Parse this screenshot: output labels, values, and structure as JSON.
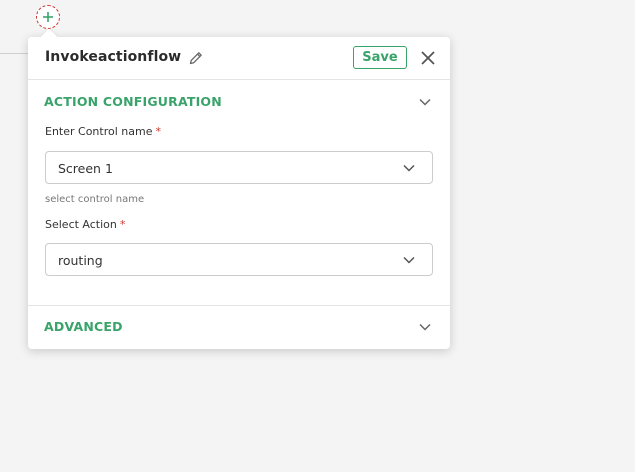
{
  "panel": {
    "title": "Invokeactionflow",
    "save_label": "Save"
  },
  "action_configuration": {
    "heading": "ACTION CONFIGURATION",
    "control_name": {
      "label": "Enter Control name",
      "required_marker": "*",
      "value": "Screen 1",
      "helper": "select control name"
    },
    "action": {
      "label": "Select Action",
      "required_marker": "*",
      "value": "routing"
    }
  },
  "advanced": {
    "heading": "ADVANCED"
  },
  "icons": {
    "add": "plus-icon",
    "edit": "pencil-icon",
    "close": "close-icon",
    "expand": "chevron-down-icon"
  },
  "colors": {
    "accent": "#3aa36a",
    "required": "#d0342c",
    "background": "#f4f4f4"
  }
}
